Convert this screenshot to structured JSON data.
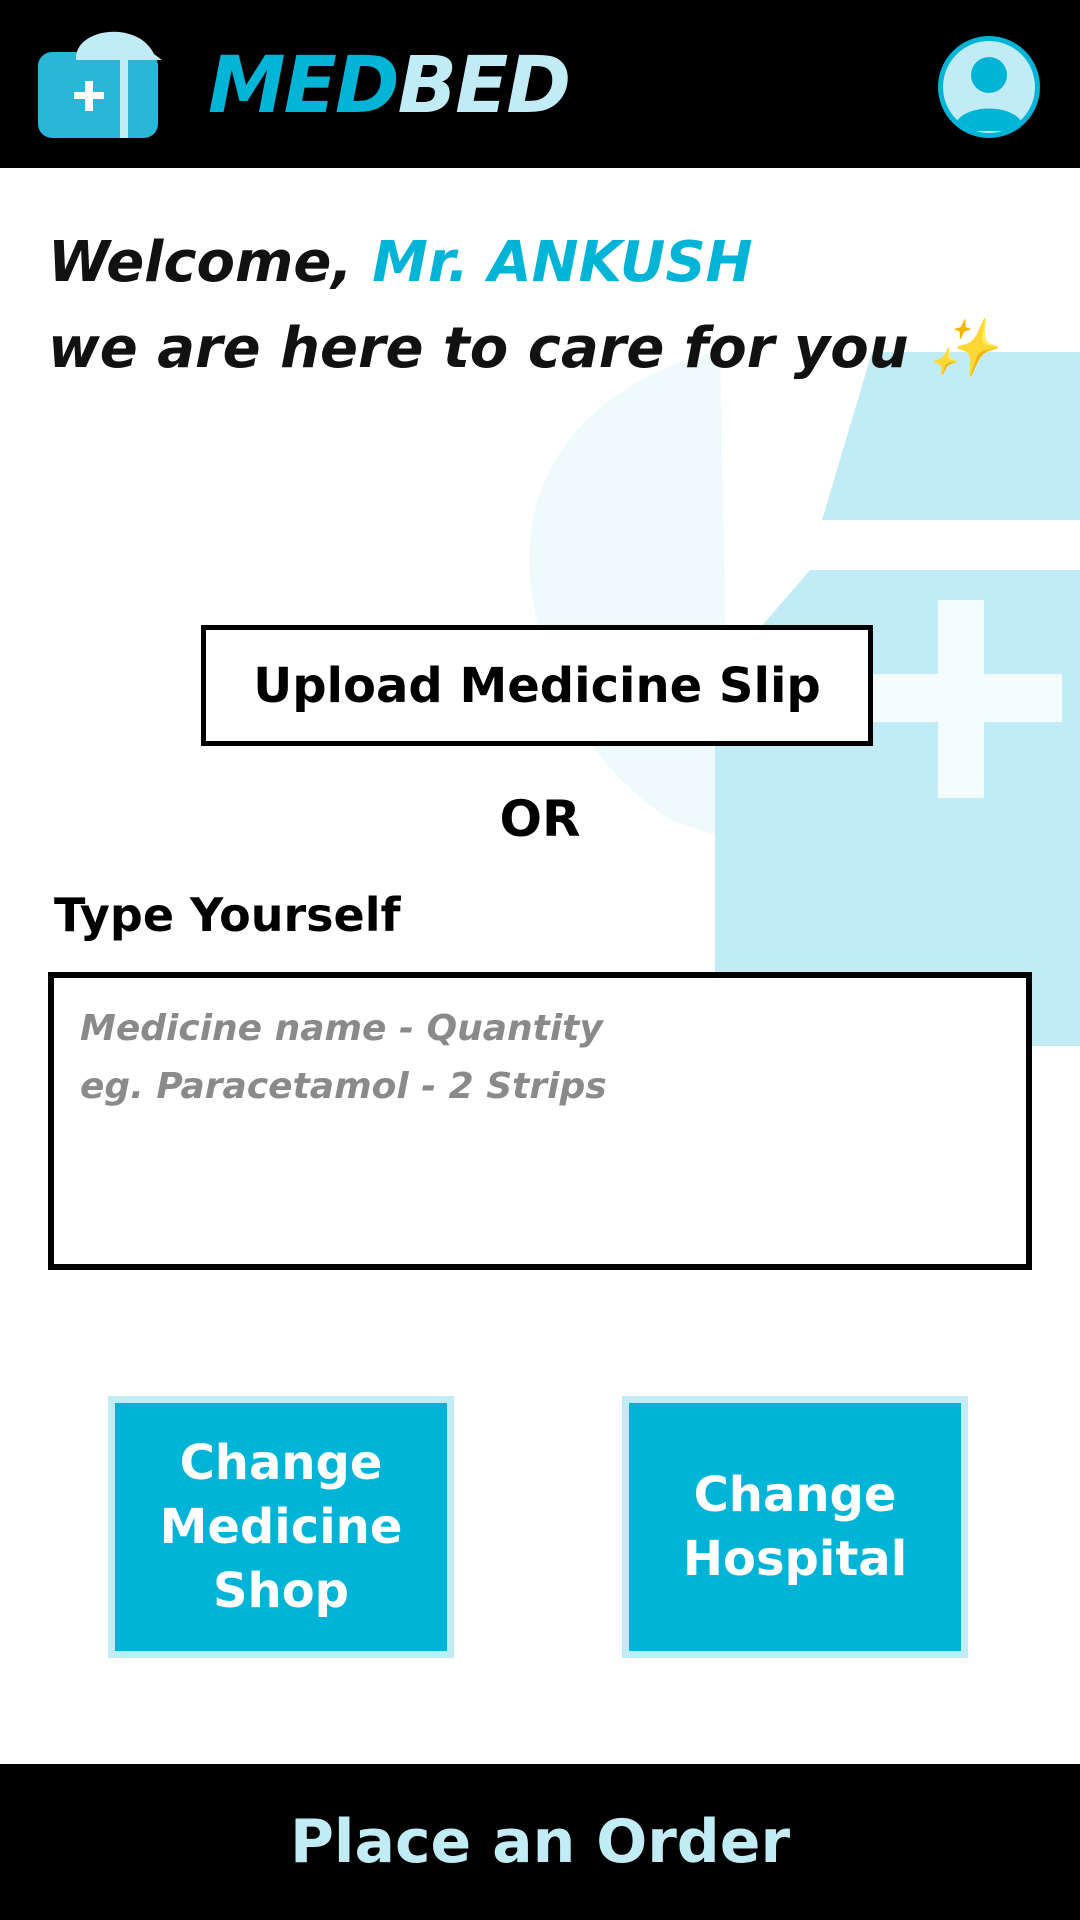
{
  "app": {
    "brand_part1": "MED",
    "brand_part2": "BED",
    "logo_icon": "medical-bed-cross-icon",
    "profile_icon": "user-avatar-icon"
  },
  "welcome": {
    "greeting": "Welcome, ",
    "name": "Mr. ANKUSH",
    "tagline": "we are here to care for you ",
    "sparkle": "✨"
  },
  "upload": {
    "label": "Upload Medicine Slip"
  },
  "or_label": "OR",
  "type_section": {
    "label": "Type Yourself",
    "placeholder": "Medicine name - Quantity\neg. Paracetamol - 2 Strips"
  },
  "actions": {
    "change_shop": "Change Medicine Shop",
    "change_hospital": "Change Hospital"
  },
  "order": {
    "label": "Place an Order"
  },
  "colors": {
    "accent": "#00b4d8",
    "accent_light": "#c2ecf5",
    "header_bg": "#000000"
  }
}
